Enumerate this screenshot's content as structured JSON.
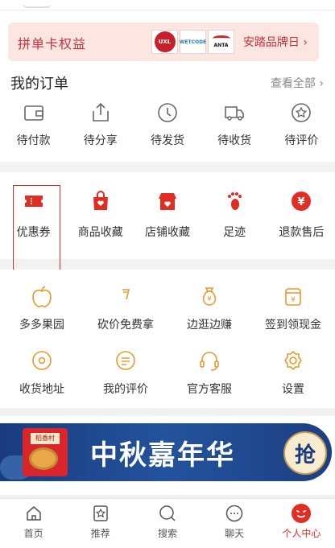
{
  "pinduan": {
    "title": "拼单卡权益",
    "right_text": "安踏品牌日",
    "brand_logos": [
      {
        "icon": "brand-logo-1",
        "text": "UXL"
      },
      {
        "icon": "brand-logo-2",
        "text": "WETCODE"
      },
      {
        "icon": "brand-logo-anta",
        "text": "ANTA"
      }
    ]
  },
  "orders": {
    "title": "我的订单",
    "view_all": "查看全部",
    "items": [
      {
        "label": "待付款",
        "icon": "wallet-icon"
      },
      {
        "label": "待分享",
        "icon": "share-icon"
      },
      {
        "label": "待发货",
        "icon": "clock-icon"
      },
      {
        "label": "待收货",
        "icon": "truck-icon"
      },
      {
        "label": "待评价",
        "icon": "review-icon"
      }
    ]
  },
  "favorites": [
    {
      "label": "优惠券",
      "icon": "coupon-icon"
    },
    {
      "label": "商品收藏",
      "icon": "bag-heart-icon"
    },
    {
      "label": "店铺收藏",
      "icon": "store-heart-icon"
    },
    {
      "label": "足迹",
      "icon": "footprint-icon"
    },
    {
      "label": "退款售后",
      "icon": "refund-icon"
    }
  ],
  "tools": {
    "row1": [
      {
        "label": "多多果园",
        "icon": "apple-icon"
      },
      {
        "label": "砍价免费拿",
        "icon": "cut-price-icon"
      },
      {
        "label": "边逛边赚",
        "icon": "money-bag-icon"
      },
      {
        "label": "签到领现金",
        "icon": "cash-jar-icon"
      }
    ],
    "row2": [
      {
        "label": "收货地址",
        "icon": "location-icon"
      },
      {
        "label": "我的评价",
        "icon": "comment-icon"
      },
      {
        "label": "官方客服",
        "icon": "headset-icon"
      },
      {
        "label": "设置",
        "icon": "gear-icon"
      }
    ]
  },
  "promo": {
    "text": "中秋嘉年华",
    "button": "抢",
    "box_tag": "稻香村"
  },
  "tabbar": [
    {
      "label": "首页",
      "icon": "home-icon"
    },
    {
      "label": "推荐",
      "icon": "star-icon"
    },
    {
      "label": "搜索",
      "icon": "search-icon"
    },
    {
      "label": "聊天",
      "icon": "chat-icon"
    },
    {
      "label": "个人中心",
      "icon": "profile-icon",
      "active": true
    }
  ],
  "colors": {
    "accent": "#e02e24",
    "icon_orange": "#e69a2e",
    "icon_gray": "#666666"
  }
}
